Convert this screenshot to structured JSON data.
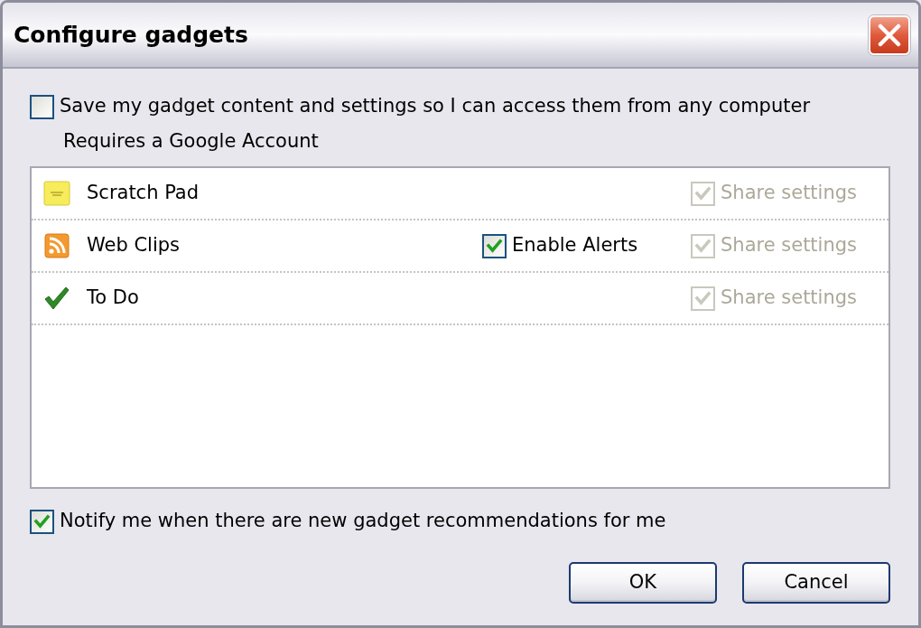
{
  "window": {
    "title": "Configure gadgets"
  },
  "sync_option": {
    "label": "Save my gadget content and settings so I can access them from any computer",
    "checked": false,
    "note": "Requires a Google Account"
  },
  "gadgets": [
    {
      "name": "Scratch Pad",
      "kind": "note",
      "share": {
        "label": "Share settings",
        "checked": true,
        "disabled": true
      }
    },
    {
      "name": "Web Clips",
      "kind": "feed",
      "alerts": {
        "label": "Enable Alerts",
        "checked": true
      },
      "share": {
        "label": "Share settings",
        "checked": true,
        "disabled": true
      }
    },
    {
      "name": "To Do",
      "kind": "task",
      "share": {
        "label": "Share settings",
        "checked": true,
        "disabled": true
      }
    }
  ],
  "notify_option": {
    "label": "Notify me when there are new gadget recommendations for me",
    "checked": true
  },
  "buttons": [
    {
      "label": "OK"
    },
    {
      "label": "Cancel"
    }
  ]
}
